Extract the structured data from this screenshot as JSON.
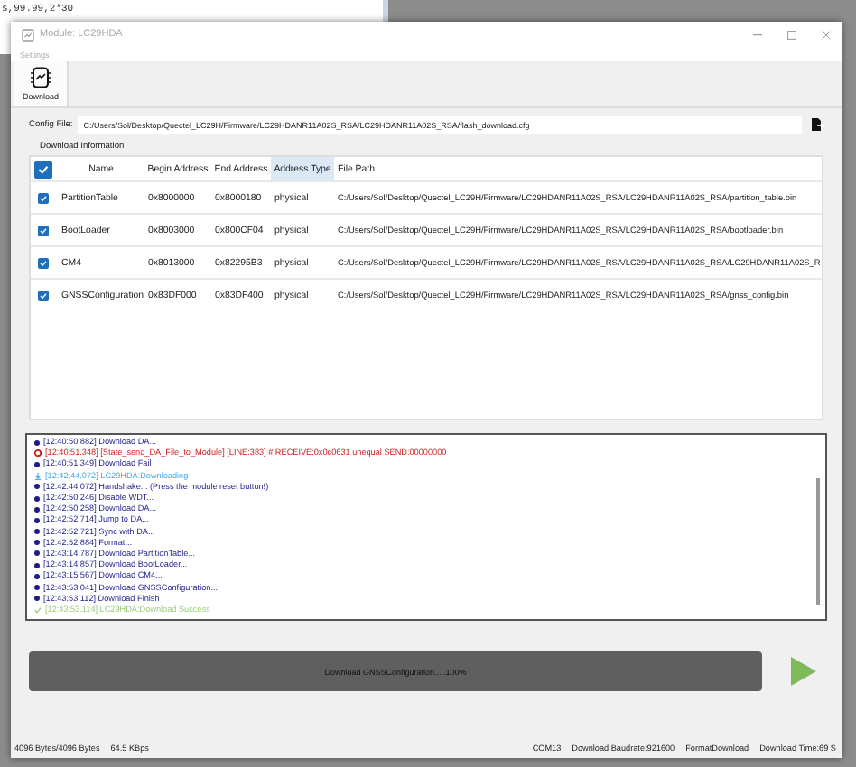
{
  "background_editor": {
    "lines": [
      "s,99.99,2*30"
    ]
  },
  "window": {
    "title": "Module: LC29HDA",
    "active": false
  },
  "menu": [
    "Settings"
  ],
  "toolbar": [
    {
      "label": "Download",
      "selected": true
    }
  ],
  "config_file": {
    "label": "Config File:",
    "value": "C:/Users/Sol/Desktop/Quectel_LC29H/Firmware/LC29HDANR11A02S_RSA/LC29HDANR11A02S_RSA/flash_download.cfg"
  },
  "section_title": "Download Information",
  "table": {
    "select_all_checked": true,
    "columns": [
      {
        "label": "Name",
        "selected": false
      },
      {
        "label": "Begin Address",
        "selected": false
      },
      {
        "label": "End Address",
        "selected": false
      },
      {
        "label": "Address Type",
        "selected": true
      },
      {
        "label": "File Path",
        "selected": false
      }
    ],
    "rows": [
      {
        "checked": true,
        "cells": [
          "PartitionTable",
          "0x8000000",
          "0x8000180",
          "physical",
          "C:/Users/Sol/Desktop/Quectel_LC29H/Firmware/LC29HDANR11A02S_RSA/LC29HDANR11A02S_RSA/partition_table.bin"
        ]
      },
      {
        "checked": true,
        "cells": [
          "BootLoader",
          "0x8003000",
          "0x800CF04",
          "physical",
          "C:/Users/Sol/Desktop/Quectel_LC29H/Firmware/LC29HDANR11A02S_RSA/LC29HDANR11A02S_RSA/bootloader.bin"
        ]
      },
      {
        "checked": true,
        "cells": [
          "CM4",
          "0x8013000",
          "0x82295B3",
          "physical",
          "C:/Users/Sol/Desktop/Quectel_LC29H/Firmware/LC29HDANR11A02S_RSA/LC29HDANR11A02S_RSA/LC29HDANR11A02S_R"
        ]
      },
      {
        "checked": true,
        "cells": [
          "GNSSConfiguration",
          "0x83DF000",
          "0x83DF400",
          "physical",
          "C:/Users/Sol/Desktop/Quectel_LC29H/Firmware/LC29HDANR11A02S_RSA/LC29HDANR11A02S_RSA/gnss_config.bin"
        ]
      }
    ]
  },
  "log": [
    {
      "kind": "info",
      "text": "[12:40:50.882] Download DA..."
    },
    {
      "kind": "error",
      "text": "[12:40:51.348] [State_send_DA_File_to_Module] [LINE:383] # RECEIVE:0x0c0631 unequal SEND:00000000"
    },
    {
      "kind": "info",
      "text": "[12:40:51.349] Download Fail"
    },
    {
      "kind": "download",
      "text": "[12:42:44.072] LC29HDA:Downloading"
    },
    {
      "kind": "info",
      "text": "[12:42:44.072] Handshake... (Press the module reset button!)"
    },
    {
      "kind": "info",
      "text": "[12:42:50.246] Disable WDT..."
    },
    {
      "kind": "info",
      "text": "[12:42:50.258] Download DA..."
    },
    {
      "kind": "info",
      "text": "[12:42:52.714] Jump to DA..."
    },
    {
      "kind": "info",
      "text": "[12:42:52.721] Sync with DA..."
    },
    {
      "kind": "info",
      "text": "[12:42:52.884] Format..."
    },
    {
      "kind": "info",
      "text": "[12:43:14.787] Download PartitionTable..."
    },
    {
      "kind": "info",
      "text": "[12:43:14.857] Download BootLoader..."
    },
    {
      "kind": "info",
      "text": "[12:43:15.567] Download CM4..."
    },
    {
      "kind": "info",
      "text": "[12:43:53.041] Download GNSSConfiguration..."
    },
    {
      "kind": "info",
      "text": "[12:43:53.112] Download Finish"
    },
    {
      "kind": "success",
      "text": "[12:43:53.114] LC29HDA:Download Success"
    }
  ],
  "progress": {
    "label": "Download GNSSConfiguration.....100%",
    "level": 1.0
  },
  "status_bar": {
    "left": [
      "4096 Bytes/4096 Bytes",
      "64.5 KBps"
    ],
    "right": [
      "COM13",
      "Download Baudrate:921600",
      "FormatDownload",
      "Download Time:69 S"
    ]
  }
}
